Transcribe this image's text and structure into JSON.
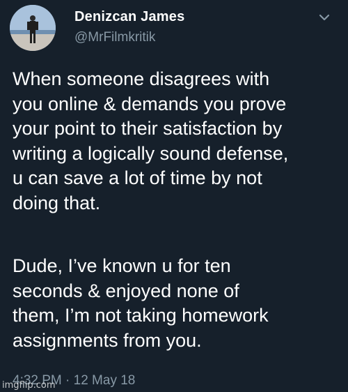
{
  "user": {
    "display_name": "Denizcan James",
    "handle": "@MrFilmkritik"
  },
  "tweet": {
    "paragraph_1": "When someone disagrees with\nyou online & demands you prove\nyour point to their satisfaction by\nwriting a logically sound defense,\nu can save a lot of time by not\ndoing that.",
    "paragraph_2": "Dude, I’ve known u for ten\nseconds & enjoyed none of\nthem, I’m not taking homework\nassignments from you.",
    "timestamp": "4:32 PM · 12 May 18"
  },
  "watermark": "imgflip.com",
  "icons": {
    "menu": "chevron-down-icon",
    "avatar": "avatar"
  },
  "colors": {
    "background": "#16202b",
    "text": "#ffffff",
    "secondary_text": "#8899a6"
  }
}
